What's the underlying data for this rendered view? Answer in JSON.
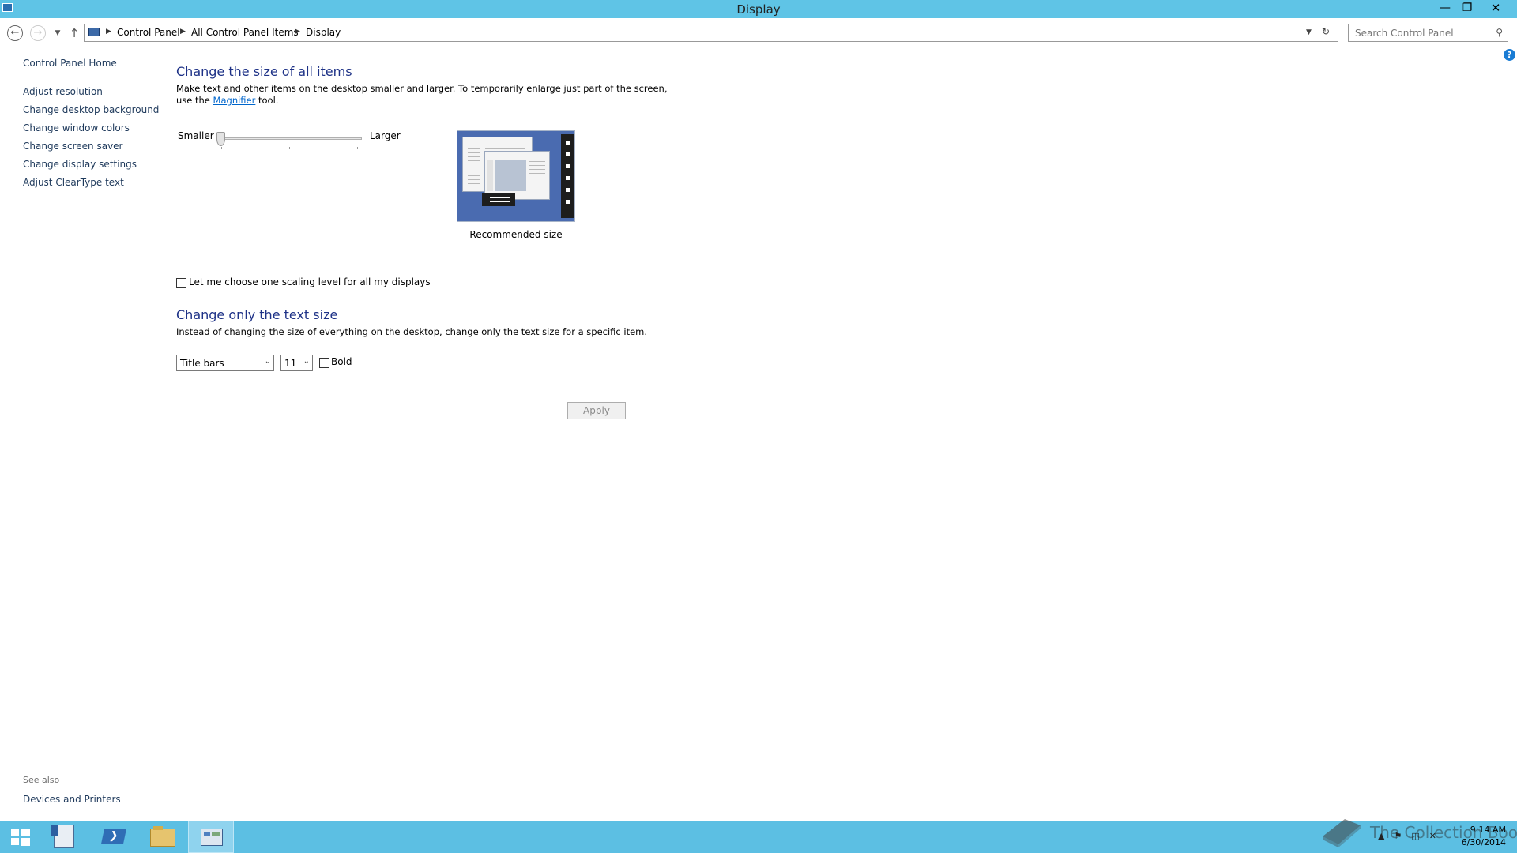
{
  "window": {
    "title": "Display"
  },
  "address": {
    "crumbs": [
      "Control Panel",
      "All Control Panel Items",
      "Display"
    ],
    "search_placeholder": "Search Control Panel"
  },
  "sidebar": {
    "home": "Control Panel Home",
    "items": [
      "Adjust resolution",
      "Change desktop background",
      "Change window colors",
      "Change screen saver",
      "Change display settings",
      "Adjust ClearType text"
    ],
    "see_also_title": "See also",
    "see_also_link": "Devices and Printers"
  },
  "main": {
    "size_heading": "Change the size of all items",
    "size_desc_1": "Make text and other items on the desktop smaller and larger. To temporarily enlarge just part of the screen,",
    "size_desc_2_pre": "use the ",
    "size_desc_link": "Magnifier",
    "size_desc_2_post": " tool.",
    "slider_min_label": "Smaller",
    "slider_max_label": "Larger",
    "slider_position": 0,
    "preview_caption": "Recommended size",
    "scaling_checkbox_label": "Let me choose one scaling level for all my displays",
    "scaling_checked": false,
    "text_heading": "Change only the text size",
    "text_desc": "Instead of changing the size of everything on the desktop, change only the text size for a specific item.",
    "item_select_value": "Title bars",
    "size_select_value": "11",
    "bold_label": "Bold",
    "bold_checked": false,
    "apply_label": "Apply"
  },
  "taskbar": {
    "time": "9:14 AM",
    "date": "6/30/2014",
    "watermark": "The Collection Book"
  },
  "colors": {
    "titlebar": "#5fc4e6",
    "taskbar": "#5cbfe3",
    "heading": "#1e3287",
    "link": "#1e395b"
  }
}
